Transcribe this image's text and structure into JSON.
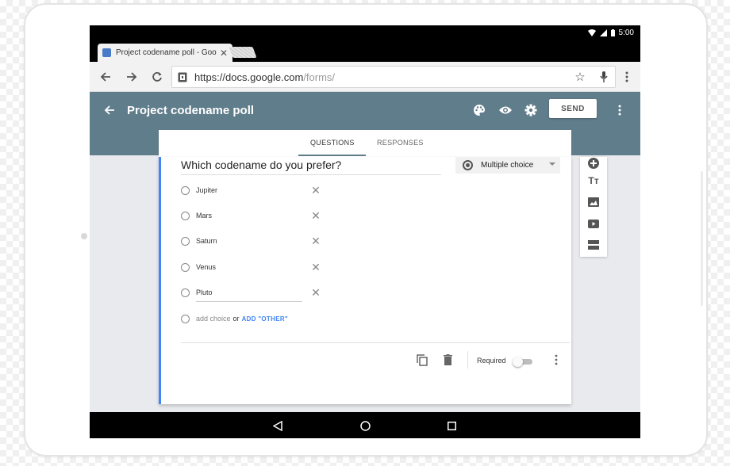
{
  "status_bar": {
    "time": "5:00"
  },
  "browser": {
    "tab": {
      "title": "Project codename poll - Goo"
    },
    "url": {
      "host": "https://docs.google.com",
      "path": "/forms/"
    }
  },
  "app": {
    "title": "Project codename poll",
    "send_label": "SEND"
  },
  "form_tabs": {
    "questions": "QUESTIONS",
    "responses": "RESPONSES"
  },
  "question": {
    "title": "Which codename do you prefer?",
    "type": "Multiple choice",
    "options": [
      "Jupiter",
      "Mars",
      "Saturn",
      "Venus",
      "Pluto"
    ],
    "add_choice": "add choice",
    "or": "or",
    "add_other": "ADD \"OTHER\"",
    "required_label": "Required"
  },
  "colors": {
    "appbar": "#607d8b",
    "accent": "#4285f4"
  }
}
